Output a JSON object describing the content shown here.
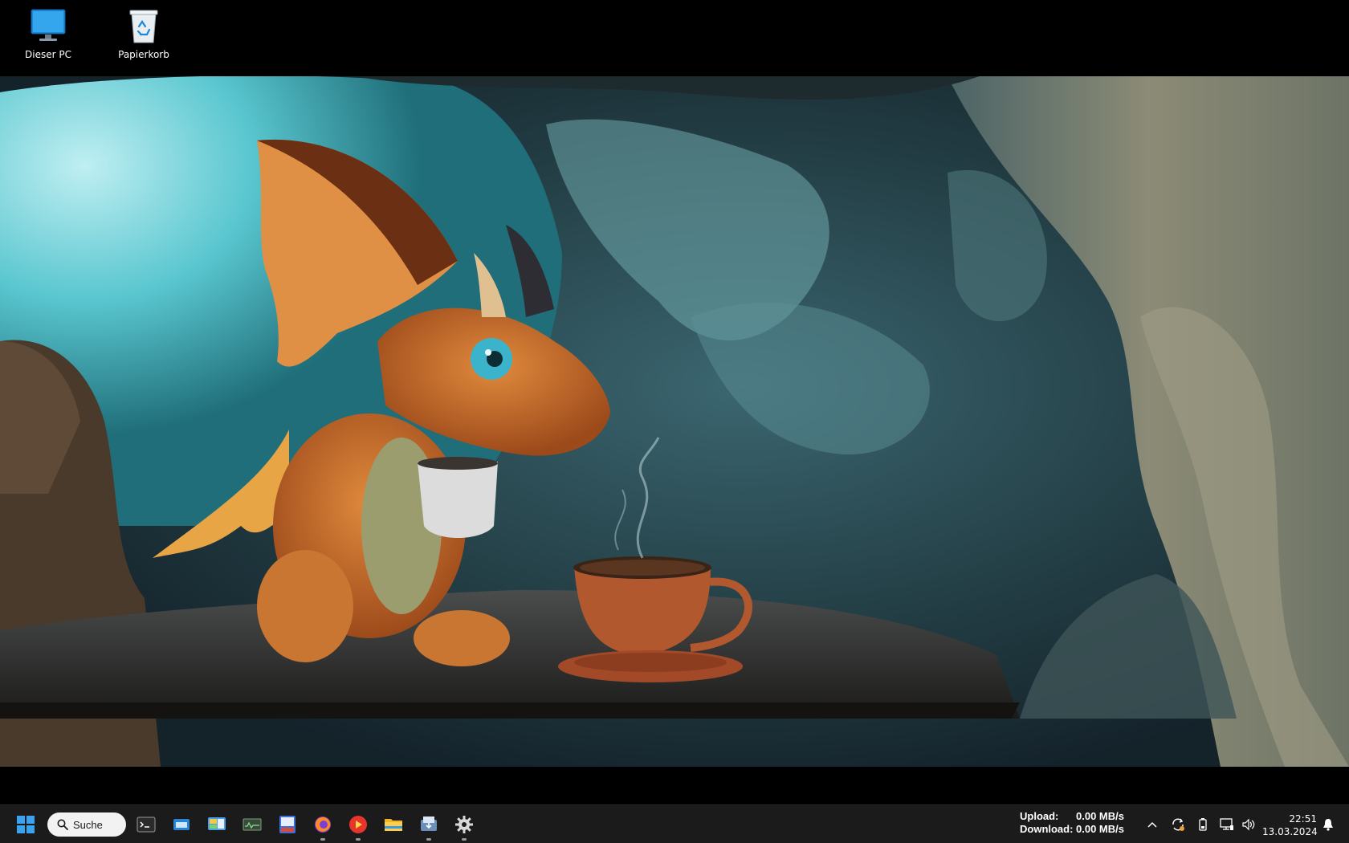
{
  "desktop": {
    "icons": [
      {
        "label": "Dieser PC",
        "icon": "computer-icon"
      },
      {
        "label": "Papierkorb",
        "icon": "recycle-bin-icon"
      }
    ]
  },
  "taskbar": {
    "start_icon": "windows-start-icon",
    "search_placeholder": "Suche",
    "apps": [
      {
        "name": "terminal-icon",
        "running": false
      },
      {
        "name": "app-window-icon",
        "running": false
      },
      {
        "name": "control-panel-icon",
        "running": false
      },
      {
        "name": "system-monitor-icon",
        "running": false
      },
      {
        "name": "id-app-icon",
        "running": false
      },
      {
        "name": "firefox-icon",
        "running": true
      },
      {
        "name": "media-player-icon",
        "running": true
      },
      {
        "name": "file-explorer-icon",
        "running": false
      },
      {
        "name": "installer-icon",
        "running": true
      },
      {
        "name": "settings-gear-icon",
        "running": true
      }
    ],
    "netspeed": {
      "upload_label": "Upload:",
      "upload_value": "0.00 MB/s",
      "download_label": "Download:",
      "download_value": "0.00 MB/s"
    },
    "tray_icons": [
      "chevron-up-icon",
      "sync-icon",
      "battery-icon",
      "network-icon",
      "volume-icon"
    ],
    "clock": {
      "time": "22:51",
      "date": "13.03.2024"
    },
    "notification_icon": "bell-icon"
  }
}
